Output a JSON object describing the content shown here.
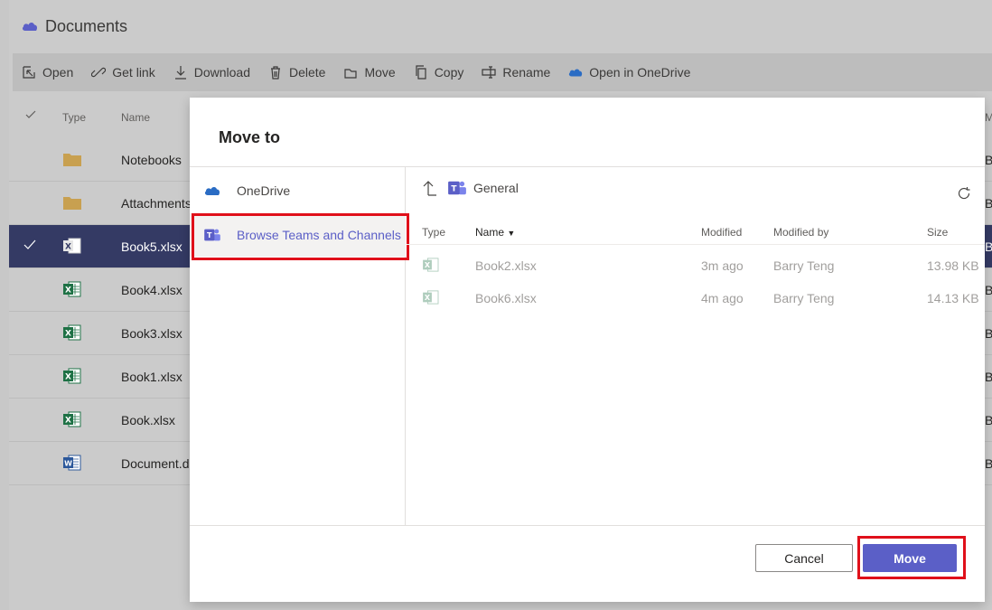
{
  "page": {
    "title": "Documents"
  },
  "toolbar": {
    "open": "Open",
    "get_link": "Get link",
    "download": "Download",
    "delete": "Delete",
    "move": "Move",
    "copy": "Copy",
    "rename": "Rename",
    "open_in_onedrive": "Open in OneDrive"
  },
  "list": {
    "col_type": "Type",
    "col_name": "Name",
    "col_right": "M",
    "right_letter": "B",
    "rows": [
      {
        "name": "Notebooks",
        "type": "folder"
      },
      {
        "name": "Attachments",
        "type": "folder"
      },
      {
        "name": "Book5.xlsx",
        "type": "excel",
        "selected": true
      },
      {
        "name": "Book4.xlsx",
        "type": "excel"
      },
      {
        "name": "Book3.xlsx",
        "type": "excel"
      },
      {
        "name": "Book1.xlsx",
        "type": "excel"
      },
      {
        "name": "Book.xlsx",
        "type": "excel"
      },
      {
        "name": "Document.d",
        "type": "word"
      }
    ]
  },
  "modal": {
    "title": "Move to",
    "nav": {
      "onedrive": "OneDrive",
      "browse_teams": "Browse Teams and Channels"
    },
    "path": {
      "current": "General"
    },
    "table": {
      "col_type": "Type",
      "col_name": "Name",
      "col_modified": "Modified",
      "col_modified_by": "Modified by",
      "col_size": "Size",
      "rows": [
        {
          "name": "Book2.xlsx",
          "modified": "3m ago",
          "modified_by": "Barry Teng",
          "size": "13.98 KB"
        },
        {
          "name": "Book6.xlsx",
          "modified": "4m ago",
          "modified_by": "Barry Teng",
          "size": "14.13 KB"
        }
      ]
    },
    "cancel_label": "Cancel",
    "move_label": "Move"
  },
  "colors": {
    "accent": "#5b5fc7",
    "highlight": "#e0101a",
    "selected_row": "#343a64",
    "excel": "#1e7145",
    "word": "#2b579a",
    "folder": "#c8a050"
  }
}
